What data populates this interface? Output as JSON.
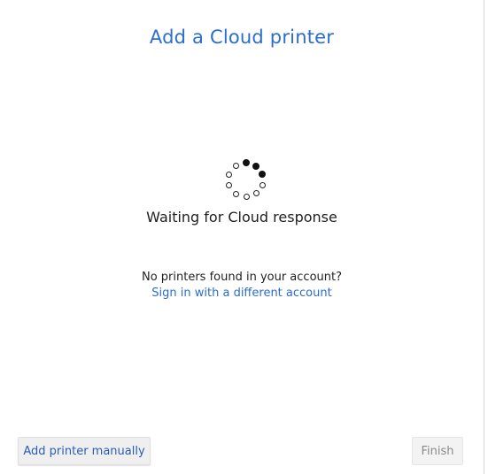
{
  "dialog": {
    "title": "Add a Cloud printer",
    "status_text": "Waiting for Cloud response",
    "no_printers_text": "No printers found in your account?",
    "sign_in_link": "Sign in with a different account",
    "spinner_icon": "loading-spinner-icon"
  },
  "buttons": {
    "add_manually_label": "Add printer manually",
    "finish_label": "Finish",
    "finish_enabled": false
  },
  "colors": {
    "accent": "#2a6dd1",
    "text": "#1f1f1f",
    "disabled_text": "#8a8a8a"
  }
}
